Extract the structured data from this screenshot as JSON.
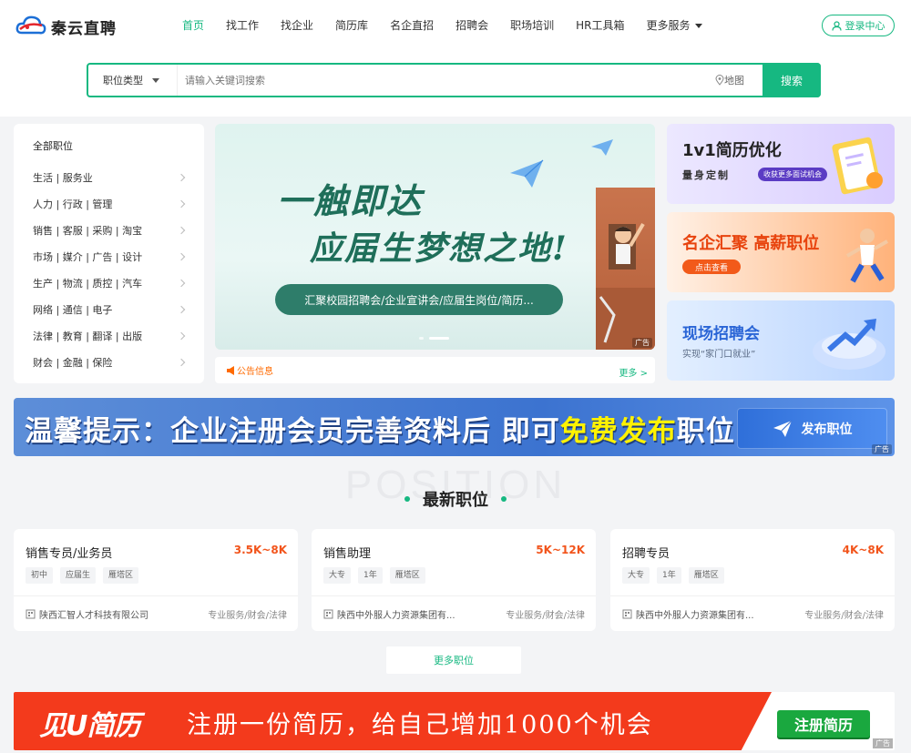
{
  "header": {
    "logo_text": "秦云直聘",
    "nav": [
      {
        "label": "首页",
        "active": true
      },
      {
        "label": "找工作",
        "active": false
      },
      {
        "label": "找企业",
        "active": false
      },
      {
        "label": "简历库",
        "active": false
      },
      {
        "label": "名企直招",
        "active": false
      },
      {
        "label": "招聘会",
        "active": false
      },
      {
        "label": "职场培训",
        "active": false
      },
      {
        "label": "HR工具箱",
        "active": false
      }
    ],
    "nav_more": "更多服务",
    "login_label": "登录中心"
  },
  "search": {
    "type_label": "职位类型",
    "placeholder": "请输入关键词搜索",
    "map_label": "地图",
    "button_label": "搜索"
  },
  "categories": {
    "title": "全部职位",
    "items": [
      "生活 | 服务业",
      "人力 | 行政 | 管理",
      "销售 | 客服 | 采购 | 淘宝",
      "市场 | 媒介 | 广告 | 设计",
      "生产 | 物流 | 质控 | 汽车",
      "网络 | 通信 | 电子",
      "法律 | 教育 | 翻译 | 出版",
      "财会 | 金融 | 保险"
    ]
  },
  "banner": {
    "line1": "一触即达",
    "line2": "应届生梦想之地!",
    "pill": "汇聚校园招聘会/企业宣讲会/应届生岗位/简历...",
    "ad_tag": "广告"
  },
  "notice": {
    "label": "公告信息",
    "more": "更多 >"
  },
  "ads": {
    "ad1_title": "1v1简历优化",
    "ad1_sub": "量身定制",
    "ad1_chip": "收获更多面试机会",
    "ad2_title": "名企汇聚 高薪职位",
    "ad2_btn": "点击查看",
    "ad3_title": "现场招聘会",
    "ad3_sub": "实现“家门口就业”"
  },
  "tip": {
    "prefix": "温馨提示：企业注册会员完善资料后 即可",
    "highlight": "免费发布",
    "suffix": "职位",
    "button": "发布职位",
    "ad_tag": "广告"
  },
  "section": {
    "bg_text": "POSITION",
    "title": "最新职位"
  },
  "jobs": [
    {
      "name": "销售专员/业务员",
      "salary": "3.5K~8K",
      "tags": [
        "初中",
        "应届生",
        "雁塔区"
      ],
      "company": "陕西汇智人才科技有限公司",
      "industry": "专业服务/财会/法律"
    },
    {
      "name": "销售助理",
      "salary": "5K~12K",
      "tags": [
        "大专",
        "1年",
        "雁塔区"
      ],
      "company": "陕西中外服人力资源集团有...",
      "industry": "专业服务/财会/法律"
    },
    {
      "name": "招聘专员",
      "salary": "4K~8K",
      "tags": [
        "大专",
        "1年",
        "雁塔区"
      ],
      "company": "陕西中外服人力资源集团有...",
      "industry": "专业服务/财会/法律"
    }
  ],
  "more_jobs": "更多职位",
  "resume_banner": {
    "logo": "见U简历",
    "text": "注册一份简历，给自己增加1000个机会",
    "button": "注册简历",
    "ad_tag": "广告"
  },
  "colors": {
    "brand": "#16b881",
    "salary": "#f2541b",
    "tip_bg": "#3c73d0",
    "highlight": "#fff200",
    "resume_red": "#f33a1c"
  }
}
